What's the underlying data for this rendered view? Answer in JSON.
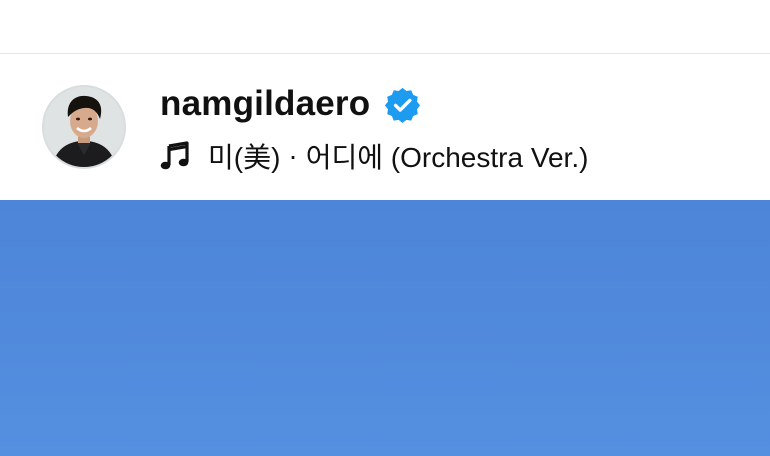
{
  "post": {
    "username": "namgildaero",
    "verified": true,
    "audio": {
      "song": "미(美)",
      "separator": "·",
      "artist_title": "어디에 (Orchestra Ver.)"
    }
  },
  "icons": {
    "avatar": "profile-avatar",
    "verified": "verified-badge-icon",
    "music": "music-note-icon"
  },
  "colors": {
    "verified_blue": "#1d9bf0",
    "text": "#111111",
    "media_sky": "#5089db"
  }
}
